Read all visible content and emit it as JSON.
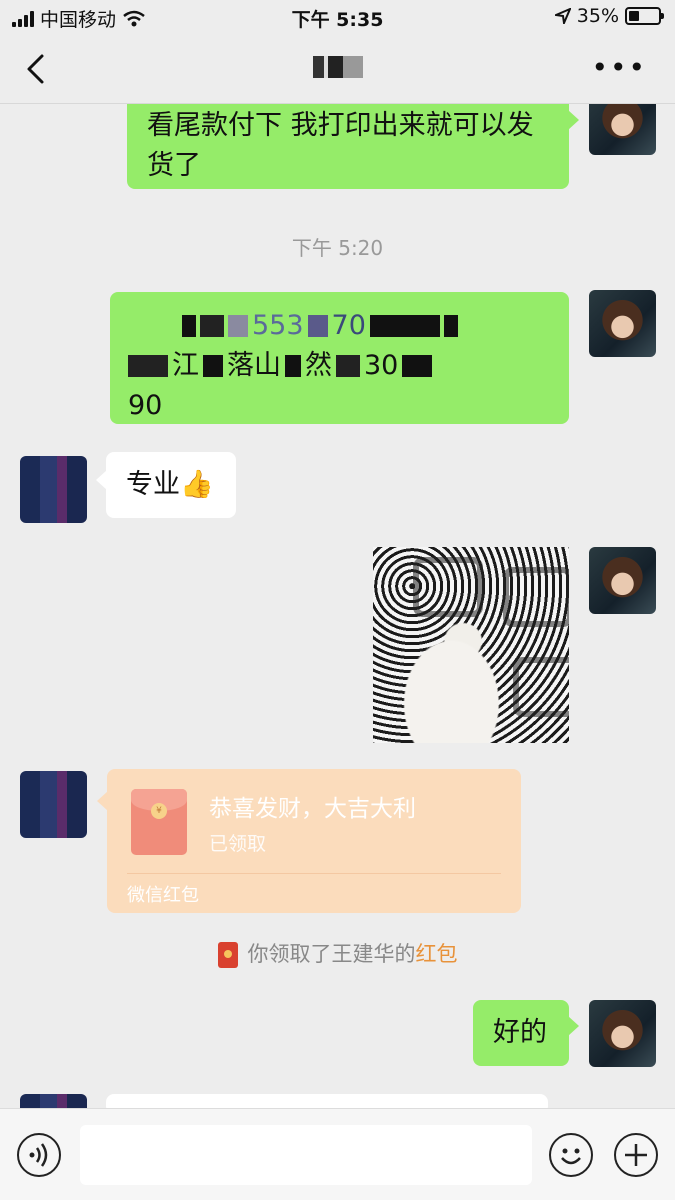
{
  "status_bar": {
    "carrier": "中国移动",
    "time": "下午 5:35",
    "battery_percent": "35%",
    "battery_level": 0.35
  },
  "nav": {
    "title": "",
    "back_icon": "chevron-left-icon",
    "more_icon": "more-dots-icon",
    "more_label": "•••"
  },
  "messages": {
    "m1_text": "看尾款付下 我打印出来就可以发货了",
    "timestamp_1": "下午 5:20",
    "m2_line1": "553",
    "m2_line1b": "70",
    "m2_line2a": "江",
    "m2_line2b": "落山",
    "m2_line2c": "然",
    "m2_line2d": "30",
    "m2_line3": "90",
    "m3_text": "专业👍",
    "m4_photo": "photo",
    "red_packet": {
      "title": "恭喜发财，大吉大利",
      "status": "已领取",
      "footer": "微信红包",
      "coin": "¥"
    },
    "system_note": {
      "prefix": "你领取了王建华的",
      "link": "红包"
    },
    "m6_text": "好的"
  },
  "input_bar": {
    "voice_icon": "voice-icon",
    "emoji_icon": "emoji-icon",
    "plus_icon": "plus-icon",
    "placeholder": ""
  },
  "colors": {
    "green_bubble": "#95ec69",
    "red_packet_bg": "#fbdcbc",
    "link_orange": "#e8923a"
  }
}
